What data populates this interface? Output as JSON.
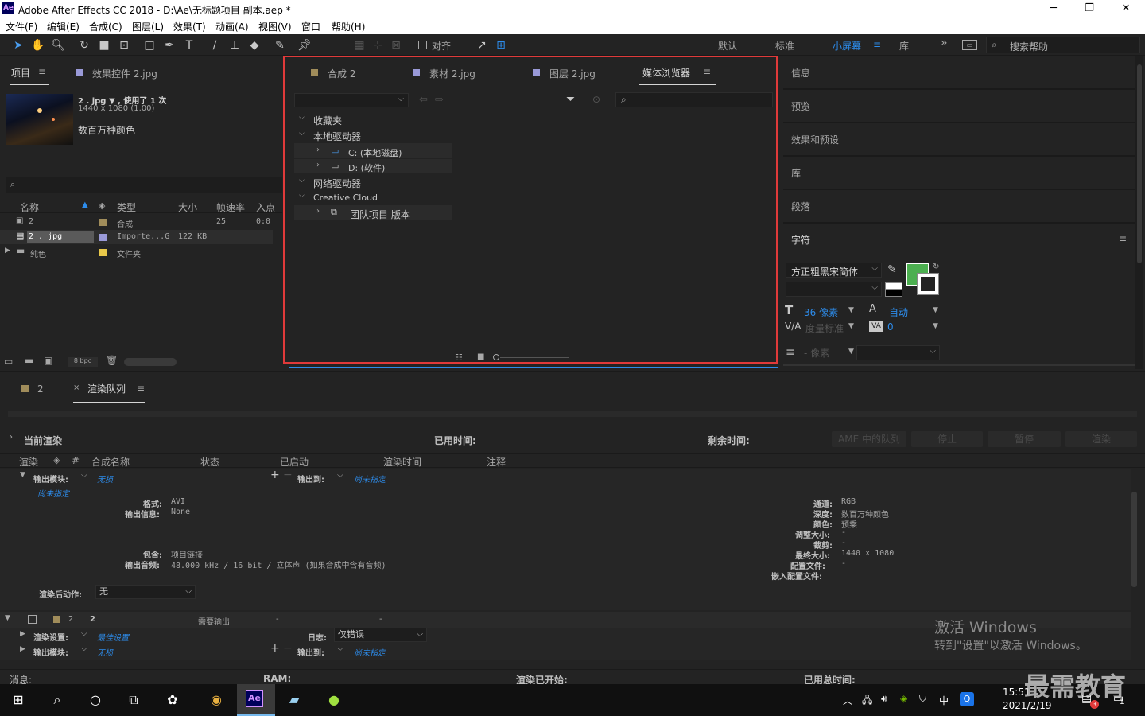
{
  "window": {
    "title": "Adobe After Effects CC 2018 - D:\\Ae\\无标题项目 副本.aep *",
    "logo": "Ae",
    "minimize": "─",
    "maximize": "❐",
    "close": "✕"
  },
  "menu": [
    "文件(F)",
    "编辑(E)",
    "合成(C)",
    "图层(L)",
    "效果(T)",
    "动画(A)",
    "视图(V)",
    "窗口",
    "帮助(H)"
  ],
  "toolbar": {
    "align_label": "对齐"
  },
  "workspaces": {
    "items": [
      "默认",
      "标准",
      "小屏幕",
      "库"
    ],
    "active": "小屏幕",
    "more": "»",
    "search_placeholder": "搜索帮助"
  },
  "project": {
    "tabs": [
      "项目",
      "效果控件 2.jpg"
    ],
    "item_name": "2 . jpg ▼ , 使用了 1 次",
    "item_dims": "1440 x 1080 (1.00)",
    "item_color": "数百万种颜色",
    "search_placeholder": "",
    "columns": [
      "名称",
      "类型",
      "大小",
      "帧速率",
      "入点"
    ],
    "rows": [
      {
        "name": "2",
        "type": "合成",
        "size": "",
        "fps": "25",
        "in": "0:0",
        "label_color": "#a08c5a"
      },
      {
        "name": "2 . jpg",
        "type": "Importe...G",
        "size": "122 KB",
        "fps": "",
        "in": "",
        "label_color": "#9a9ad8"
      },
      {
        "name": "纯色",
        "type": "文件夹",
        "size": "",
        "fps": "",
        "in": "",
        "label_color": "#e8c84a"
      }
    ],
    "bpc": "8 bpc"
  },
  "media_browser": {
    "tabs": [
      "合成 2",
      "素材 2.jpg",
      "图层 2.jpg",
      "媒体浏览器"
    ],
    "active_tab": "媒体浏览器",
    "tree": [
      {
        "label": "收藏夹",
        "level": 0,
        "arrow": "v"
      },
      {
        "label": "本地驱动器",
        "level": 0,
        "arrow": "v"
      },
      {
        "label": "C: (本地磁盘)",
        "level": 1,
        "arrow": ">"
      },
      {
        "label": "D: (软件)",
        "level": 1,
        "arrow": ">"
      },
      {
        "label": "网络驱动器",
        "level": 0,
        "arrow": "v"
      },
      {
        "label": "Creative Cloud",
        "level": 0,
        "arrow": "v"
      },
      {
        "label": "团队项目 版本",
        "level": 1,
        "arrow": ">"
      }
    ]
  },
  "right_panels": [
    "信息",
    "预览",
    "效果和预设",
    "库",
    "段落"
  ],
  "character": {
    "title": "字符",
    "font": "方正粗黑宋简体",
    "style": "-",
    "size": "36 像素",
    "leading": "自动",
    "kerning": "度量标准",
    "tracking": "0",
    "stroke": "- 像素",
    "fill_color": "#4caf50"
  },
  "render": {
    "tabs": [
      "2",
      "渲染队列"
    ],
    "current_render": "当前渲染",
    "elapsed": "已用时间:",
    "remaining": "剩余时间:",
    "buttons": [
      "AME 中的队列",
      "停止",
      "暂停",
      "渲染"
    ],
    "columns": [
      "渲染",
      "#",
      "合成名称",
      "状态",
      "已启动",
      "渲染时间",
      "注释"
    ],
    "output_module_label": "输出模块:",
    "output_module": "无损",
    "output_to_label": "输出到:",
    "output_to": "尚未指定",
    "unspecified": "尚未指定",
    "left_info": [
      [
        "格式:",
        "AVI"
      ],
      [
        "输出信息:",
        "None"
      ],
      [
        "包含:",
        "项目链接"
      ],
      [
        "输出音频:",
        "48.000 kHz / 16 bit / 立体声 (如果合成中含有音频)"
      ]
    ],
    "right_info": [
      [
        "通道:",
        "RGB"
      ],
      [
        "深度:",
        "数百万种颜色"
      ],
      [
        "颜色:",
        "预乘"
      ],
      [
        "调整大小:",
        "-"
      ],
      [
        "裁剪:",
        "-"
      ],
      [
        "最终大小:",
        "1440 x 1080"
      ],
      [
        "配置文件:",
        "-"
      ],
      [
        "嵌入配置文件:",
        ""
      ]
    ],
    "post_render_label": "渲染后动作:",
    "post_render": "无",
    "item": {
      "num": "2",
      "name": "2",
      "status": "需要输出",
      "started": "-",
      "time": "-"
    },
    "render_settings_label": "渲染设置:",
    "render_settings": "最佳设置",
    "log_label": "日志:",
    "log": "仅错误",
    "status_bar": {
      "msg": "消息:",
      "ram": "RAM:",
      "started": "渲染已开始:",
      "total": "已用总时间:"
    }
  },
  "watermark": {
    "line1": "激活 Windows",
    "line2": "转到\"设置\"以激活 Windows。",
    "brand": "最需教育"
  },
  "taskbar": {
    "time": "15:51",
    "date": "2021/2/19",
    "ime": "中",
    "badge": "3",
    "notify": "1"
  }
}
